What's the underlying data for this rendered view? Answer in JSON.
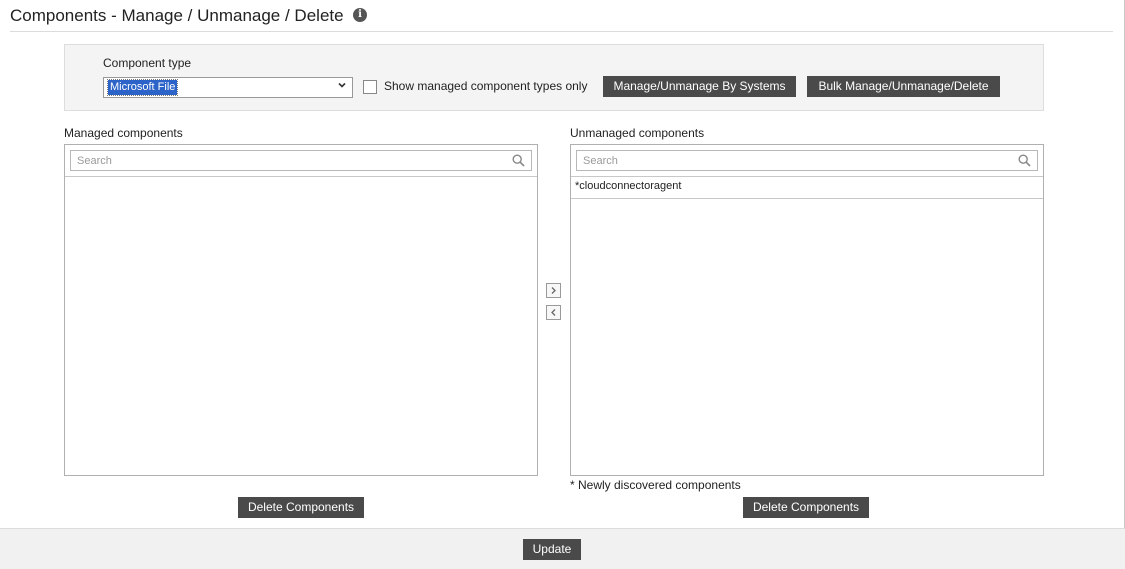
{
  "header": {
    "title": "Components - Manage / Unmanage / Delete",
    "info_icon": "info-icon"
  },
  "filter": {
    "component_type_label": "Component type",
    "component_type_value": "Microsoft File",
    "show_managed_only_label": "Show managed component types only",
    "show_managed_only_checked": false,
    "manage_by_systems_label": "Manage/Unmanage By Systems",
    "bulk_label": "Bulk Manage/Unmanage/Delete"
  },
  "managed": {
    "heading": "Managed components",
    "search_placeholder": "Search",
    "items": []
  },
  "unmanaged": {
    "heading": "Unmanaged components",
    "search_placeholder": "Search",
    "items": [
      "*cloudconnectoragent"
    ]
  },
  "transfer": {
    "move_right_icon": "chevron-right-icon",
    "move_left_icon": "chevron-left-icon"
  },
  "footnote": "* Newly discovered components",
  "buttons": {
    "delete_managed": "Delete Components",
    "delete_unmanaged": "Delete Components",
    "update": "Update"
  },
  "colors": {
    "button_bg": "#4a4a4a",
    "selection": "#2b63c9",
    "panel_bg": "#f4f4f4"
  }
}
